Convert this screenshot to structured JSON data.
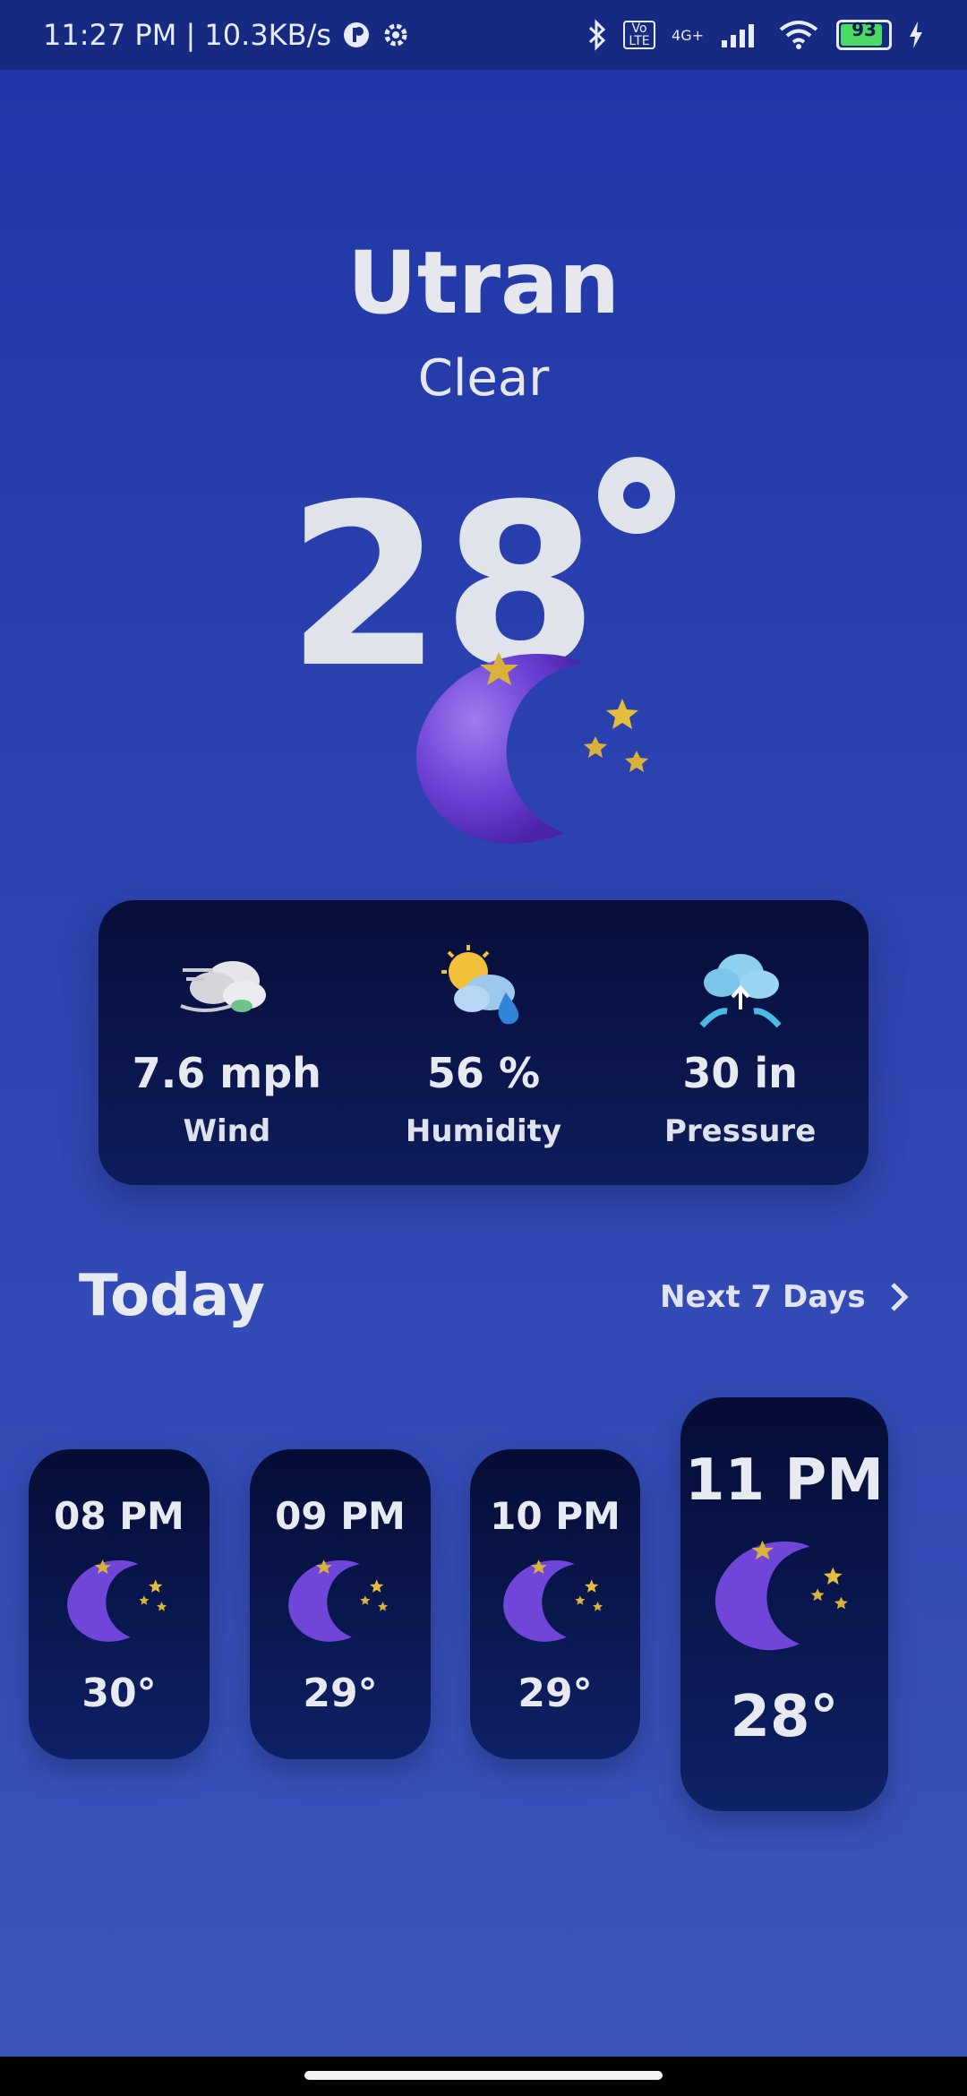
{
  "status_bar": {
    "time_speed": "11:27 PM | 10.3KB/s",
    "network": "4G+",
    "volte": "Vo LTE",
    "battery": "93"
  },
  "location": {
    "city": "Utran",
    "condition": "Clear",
    "temperature": "28"
  },
  "metrics": [
    {
      "value": "7.6 mph",
      "label": "Wind",
      "icon": "wind-cloud-icon"
    },
    {
      "value": "56 %",
      "label": "Humidity",
      "icon": "humidity-icon"
    },
    {
      "value": "30 in",
      "label": "Pressure",
      "icon": "pressure-icon"
    }
  ],
  "today": {
    "title": "Today",
    "next_link": "Next 7 Days",
    "hours": [
      {
        "time": "08 PM",
        "temp": "30°"
      },
      {
        "time": "09 PM",
        "temp": "29°"
      },
      {
        "time": "10 PM",
        "temp": "29°"
      },
      {
        "time": "11 PM",
        "temp": "28°"
      }
    ]
  },
  "colors": {
    "background_top": "#1f36a6",
    "background_bottom": "#3a55bd",
    "card_dark": "#070d38",
    "moon_purple": "#7b4de0",
    "star_gold": "#e0b832"
  }
}
